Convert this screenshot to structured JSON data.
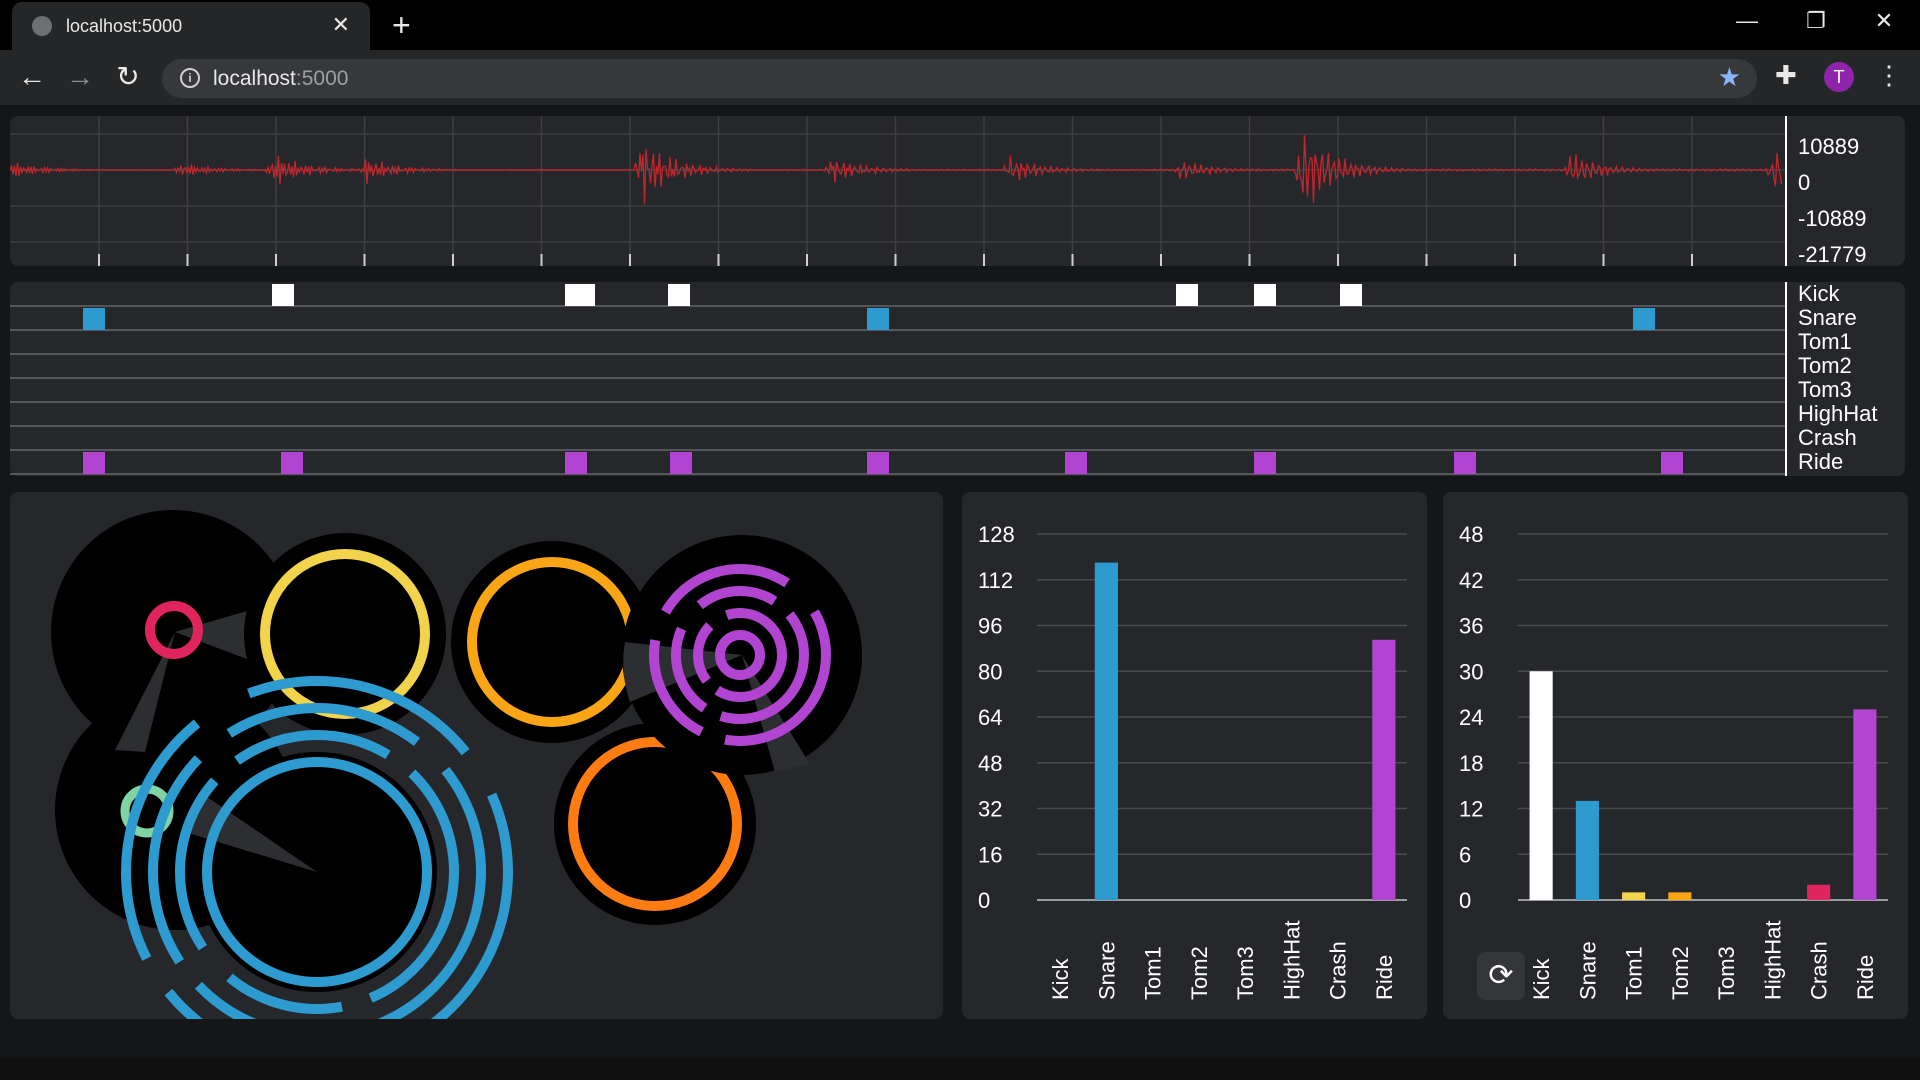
{
  "browser": {
    "tab_title": "localhost:5000",
    "new_tab_label": "+",
    "url_host": "localhost",
    "url_port": ":5000",
    "profile_initial": "T",
    "accent_color": "#8ab4f8",
    "profile_color": "#8e24aa"
  },
  "waveform": {
    "y_ticks": [
      "10889",
      "0",
      "-10889",
      "-21779"
    ],
    "line_color": "#c0272d"
  },
  "pattern": {
    "instruments": [
      "Kick",
      "Snare",
      "Tom1",
      "Tom2",
      "Tom3",
      "HighHat",
      "Crash",
      "Ride"
    ],
    "colors": {
      "Kick": "#ffffff",
      "Snare": "#2e9bd0",
      "Ride": "#b145d1"
    }
  },
  "drum_colors": {
    "Kick": "#ffffff",
    "Snare": "#2e9bd0",
    "Tom1": "#f2d34c",
    "Tom2": "#f9a515",
    "Tom3": "#ff7c12",
    "HighHat": "#7fd3a5",
    "Crash": "#e0245e",
    "Ride": "#b145d1"
  },
  "charts": {
    "refresh_icon": "refresh-icon"
  },
  "chart_data": [
    {
      "type": "bar",
      "categories": [
        "Kick",
        "Snare",
        "Tom1",
        "Tom2",
        "Tom3",
        "HighHat",
        "Crash",
        "Ride"
      ],
      "values": [
        0,
        118,
        0,
        0,
        0,
        0,
        0,
        91
      ],
      "ylim": [
        0,
        128
      ],
      "y_ticks": [
        "128",
        "112",
        "96",
        "80",
        "64",
        "48",
        "32",
        "16",
        "0"
      ],
      "grid": true
    },
    {
      "type": "bar",
      "categories": [
        "Kick",
        "Snare",
        "Tom1",
        "Tom2",
        "Tom3",
        "HighHat",
        "Crash",
        "Ride"
      ],
      "values": [
        30,
        13,
        1,
        1,
        0,
        0,
        2,
        25
      ],
      "ylim": [
        0,
        48
      ],
      "y_ticks": [
        "48",
        "42",
        "36",
        "30",
        "24",
        "18",
        "12",
        "6",
        "0"
      ],
      "grid": true
    }
  ]
}
